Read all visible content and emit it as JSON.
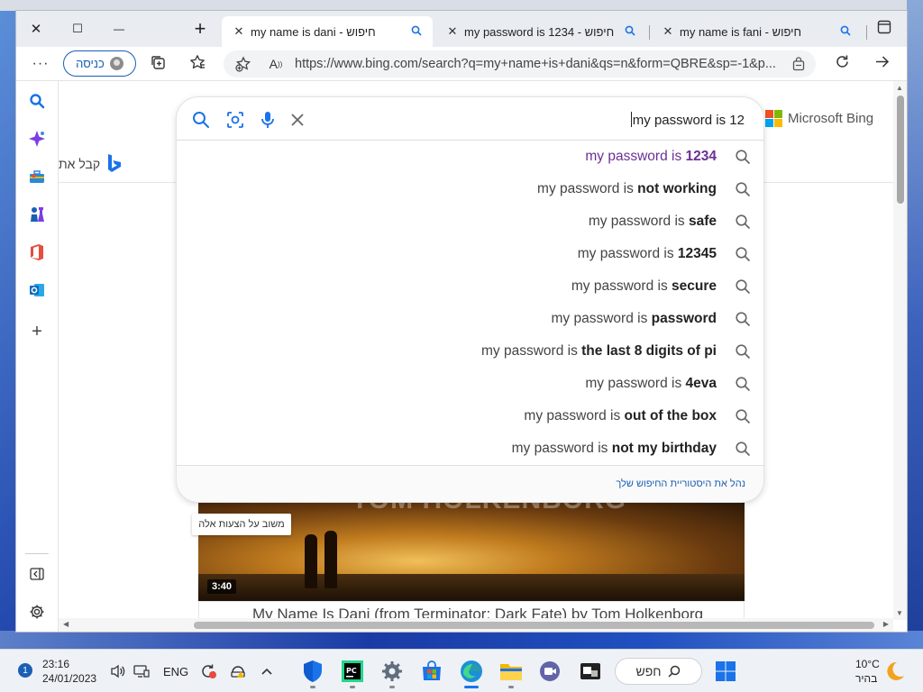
{
  "window_controls": {
    "close": "✕",
    "maximize": "☐",
    "minimize": "—",
    "new_tab": "+"
  },
  "tabs": [
    {
      "title": "my name is dani - חיפוש",
      "active": true
    },
    {
      "title": "my password is 1234 - חיפוש",
      "active": false
    },
    {
      "title": "my name is fani - חיפוש",
      "active": false
    }
  ],
  "toolbar": {
    "profile_label": "כניסה",
    "url": "https://www.bing.com/search?q=my+name+is+dani&qs=n&form=QBRE&sp=-1&p..."
  },
  "sidebar": {
    "items": [
      "search-icon",
      "copilot-icon",
      "shopping-icon",
      "games-icon",
      "office-icon",
      "outlook-icon",
      "add-icon"
    ],
    "bottom": [
      "hide-sidebar-icon",
      "settings-icon"
    ]
  },
  "page": {
    "brand": "Microsoft Bing",
    "get_bing": "קבל את",
    "search_query": "my password is 12",
    "suggestions": [
      {
        "prefix": "my password is ",
        "bold": "1234",
        "visited": true
      },
      {
        "prefix": "my password is ",
        "bold": "not working",
        "visited": false
      },
      {
        "prefix": "my password is ",
        "bold": "safe",
        "visited": false
      },
      {
        "prefix": "my password is ",
        "bold": "12345",
        "visited": false
      },
      {
        "prefix": "my password is ",
        "bold": "secure",
        "visited": false
      },
      {
        "prefix": "my password is ",
        "bold": "password",
        "visited": false
      },
      {
        "prefix": "my password is ",
        "bold": "the last 8 digits of pi",
        "visited": false
      },
      {
        "prefix": "my password is ",
        "bold": "4eva",
        "visited": false
      },
      {
        "prefix": "my password is ",
        "bold": "out of the box",
        "visited": false
      },
      {
        "prefix": "my password is ",
        "bold": "not my birthday",
        "visited": false
      }
    ],
    "manage_history": "נהל את היסטוריית החיפוש שלך",
    "feedback": "משוב על הצעות אלה",
    "video_duration": "3:40",
    "video_overlay_text": "TOM HOLKENBORG",
    "video_title": "My Name Is Dani (from Terminator: Dark Fate) by Tom Holkenborg"
  },
  "taskbar": {
    "notification_count": "1",
    "time": "23:16",
    "date": "24/01/2023",
    "language": "ENG",
    "search_label": "חפש",
    "weather_temp": "10°C",
    "weather_desc": "בהיר"
  },
  "colors": {
    "accent": "#1a5fb4",
    "visited": "#6b2f94",
    "edge_blue": "#1a73e8"
  }
}
